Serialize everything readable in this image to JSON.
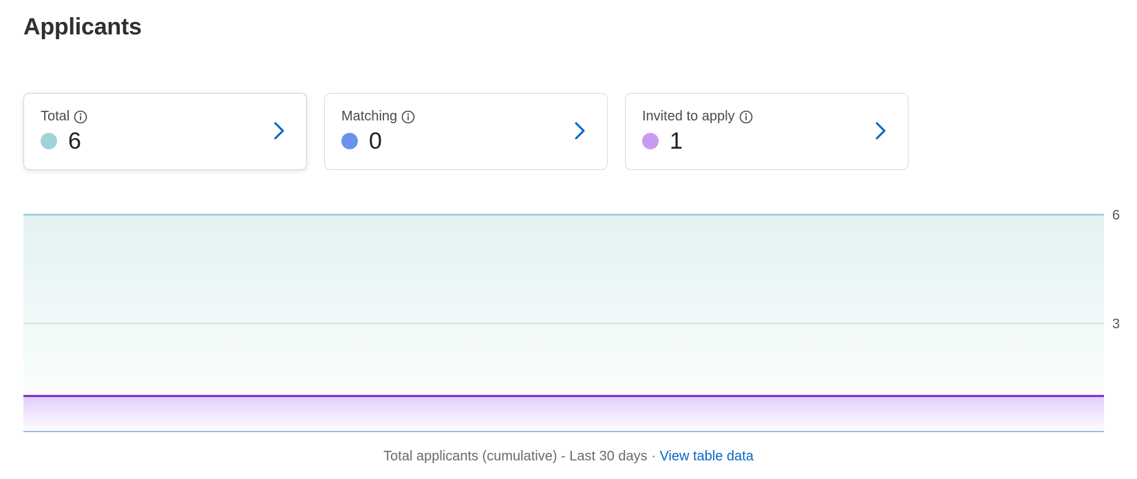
{
  "page": {
    "title": "Applicants"
  },
  "cards": [
    {
      "label": "Total",
      "value": "6",
      "color": "#9fd3d8",
      "icon": "info-icon",
      "selected": true
    },
    {
      "label": "Matching",
      "value": "0",
      "color": "#6b93ee",
      "icon": "info-icon",
      "selected": false
    },
    {
      "label": "Invited to apply",
      "value": "1",
      "color": "#c79bf2",
      "icon": "info-icon",
      "selected": false
    }
  ],
  "chart_data": {
    "type": "area",
    "ylim": [
      0,
      6
    ],
    "yticks": [
      "6",
      "3"
    ],
    "grid": true,
    "series": [
      {
        "name": "Total",
        "value": 6,
        "line_color": "#9fd3d8",
        "fill_top": "#e6f4f4",
        "fill_bottom": "#ffffff"
      },
      {
        "name": "Invited to apply",
        "value": 1,
        "line_color": "#7a2ccf",
        "fill_top": "#e9d6fb",
        "fill_bottom": "#ffffff"
      },
      {
        "name": "Matching",
        "value": 0,
        "line_color": "#7aa5e6"
      }
    ]
  },
  "footer": {
    "caption": "Total applicants (cumulative) - Last 30 days · ",
    "link_label": "View table data"
  }
}
